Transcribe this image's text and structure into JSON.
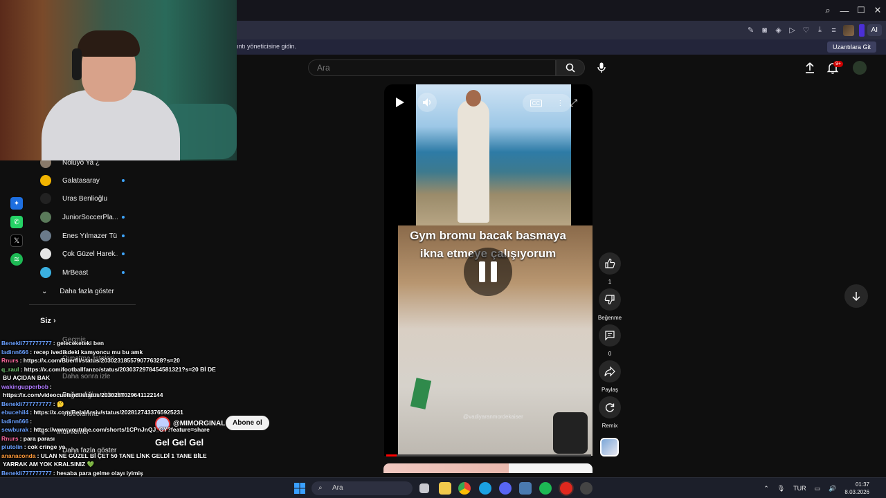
{
  "browser": {
    "info_message": "ıntı yöneticisine gidin.",
    "extensions_button": "Uzantılara Git",
    "ai_label": "AI",
    "window_controls": [
      "⌕",
      "—",
      "☐",
      "✕"
    ]
  },
  "yt": {
    "search_placeholder": "Ara",
    "notification_badge": "9+"
  },
  "sidebar": {
    "items": [
      {
        "label": "Noluyo Ya ¿",
        "new": false
      },
      {
        "label": "Galatasaray",
        "new": true
      },
      {
        "label": "Uras Benlioğlu",
        "new": false
      },
      {
        "label": "JuniorSoccerPla...",
        "new": true
      },
      {
        "label": "Enes Yılmazer Tü...",
        "new": true
      },
      {
        "label": "Çok Güzel Harek...",
        "new": true
      },
      {
        "label": "MrBeast",
        "new": true
      },
      {
        "label": "Daha fazla göster",
        "new": false
      }
    ],
    "siz_label": "Siz",
    "siz_items": [
      "Geçmiş",
      "Oynatma listeleri",
      "Daha sonra izle",
      "Beğendiğim videolar",
      "Videolarınız",
      "İndirilenler",
      "Daha fazla göster"
    ]
  },
  "short": {
    "caption_line1": "Gym bromu bacak basmaya",
    "caption_line2": "ikna etmeye çalışıyorum",
    "watermark": "@vadiyaranmordekaiser",
    "cc_label": "CC",
    "progress": 0.05
  },
  "actions": {
    "like_count": "1",
    "dislike_label": "Beğenme",
    "comment_count": "0",
    "share_label": "Paylaş",
    "remix_label": "Remix"
  },
  "channel": {
    "name": "@MIMORGINAL",
    "subscribe_label": "Abone ol",
    "title": "Gel Gel Gel"
  },
  "chat": [
    {
      "user": "Benekli777777777",
      "msg": ": geleceketeki ben",
      "color": "#6aa0ff"
    },
    {
      "user": "ladinn666",
      "msg": ": recep ivedikdeki kamyoncu mu bu amk",
      "color": "#6aa0ff"
    },
    {
      "user": "Rnurs",
      "msg": ": https://x.com/Bberfll/status/2030231855790776328?s=20",
      "color": "#ff6aa0"
    },
    {
      "user": "q_raul",
      "msg": ": https://x.com/footballfanzo/status/2030372978454581321?s=20 Bİ DE",
      "color": "#7ad17a"
    },
    {
      "user": "",
      "msg": "BU AÇIDAN BAK",
      "color": "#ffffff"
    },
    {
      "user": "wakingupperbob",
      "msg": ":",
      "color": "#b07aff"
    },
    {
      "user": "",
      "msg": "https://x.com/videocuefendi/status/2030287029641122144",
      "color": "#ffffff"
    },
    {
      "user": "Benekli777777777",
      "msg": ": 🤔",
      "color": "#6aa0ff"
    },
    {
      "user": "ebucehil4",
      "msg": ": https://x.com/BelalArsiv/status/2028127433765925231",
      "color": "#6aa0ff"
    },
    {
      "user": "ladinn666",
      "msg": ":",
      "color": "#6aa0ff"
    },
    {
      "user": "sewburak",
      "msg": ": https://www.youtube.com/shorts/1CPnJnQJ_CY?feature=share",
      "color": "#6aa0ff"
    },
    {
      "user": "Rnurs",
      "msg": ": para parası",
      "color": "#ff6aa0"
    },
    {
      "user": "plutolin",
      "msg": ": cok cringe ya",
      "color": "#6aa0ff"
    },
    {
      "user": "ananaconda",
      "msg": ": ULAN NE GÜZEL Bİ ÇET 50 TANE LİNK GELDİ 1 TANE BİLE",
      "color": "#ff9a3a"
    },
    {
      "user": "",
      "msg": "YARRAK AM YOK KRALSINIZ 💚",
      "color": "#ffffff"
    },
    {
      "user": "Benekli777777777",
      "msg": ": hesaba para gelme olayı iyimiş",
      "color": "#6aa0ff"
    }
  ],
  "taskbar": {
    "search": "Ara",
    "lang": "TUR",
    "time": "01:37",
    "date": "8.03.2026"
  }
}
